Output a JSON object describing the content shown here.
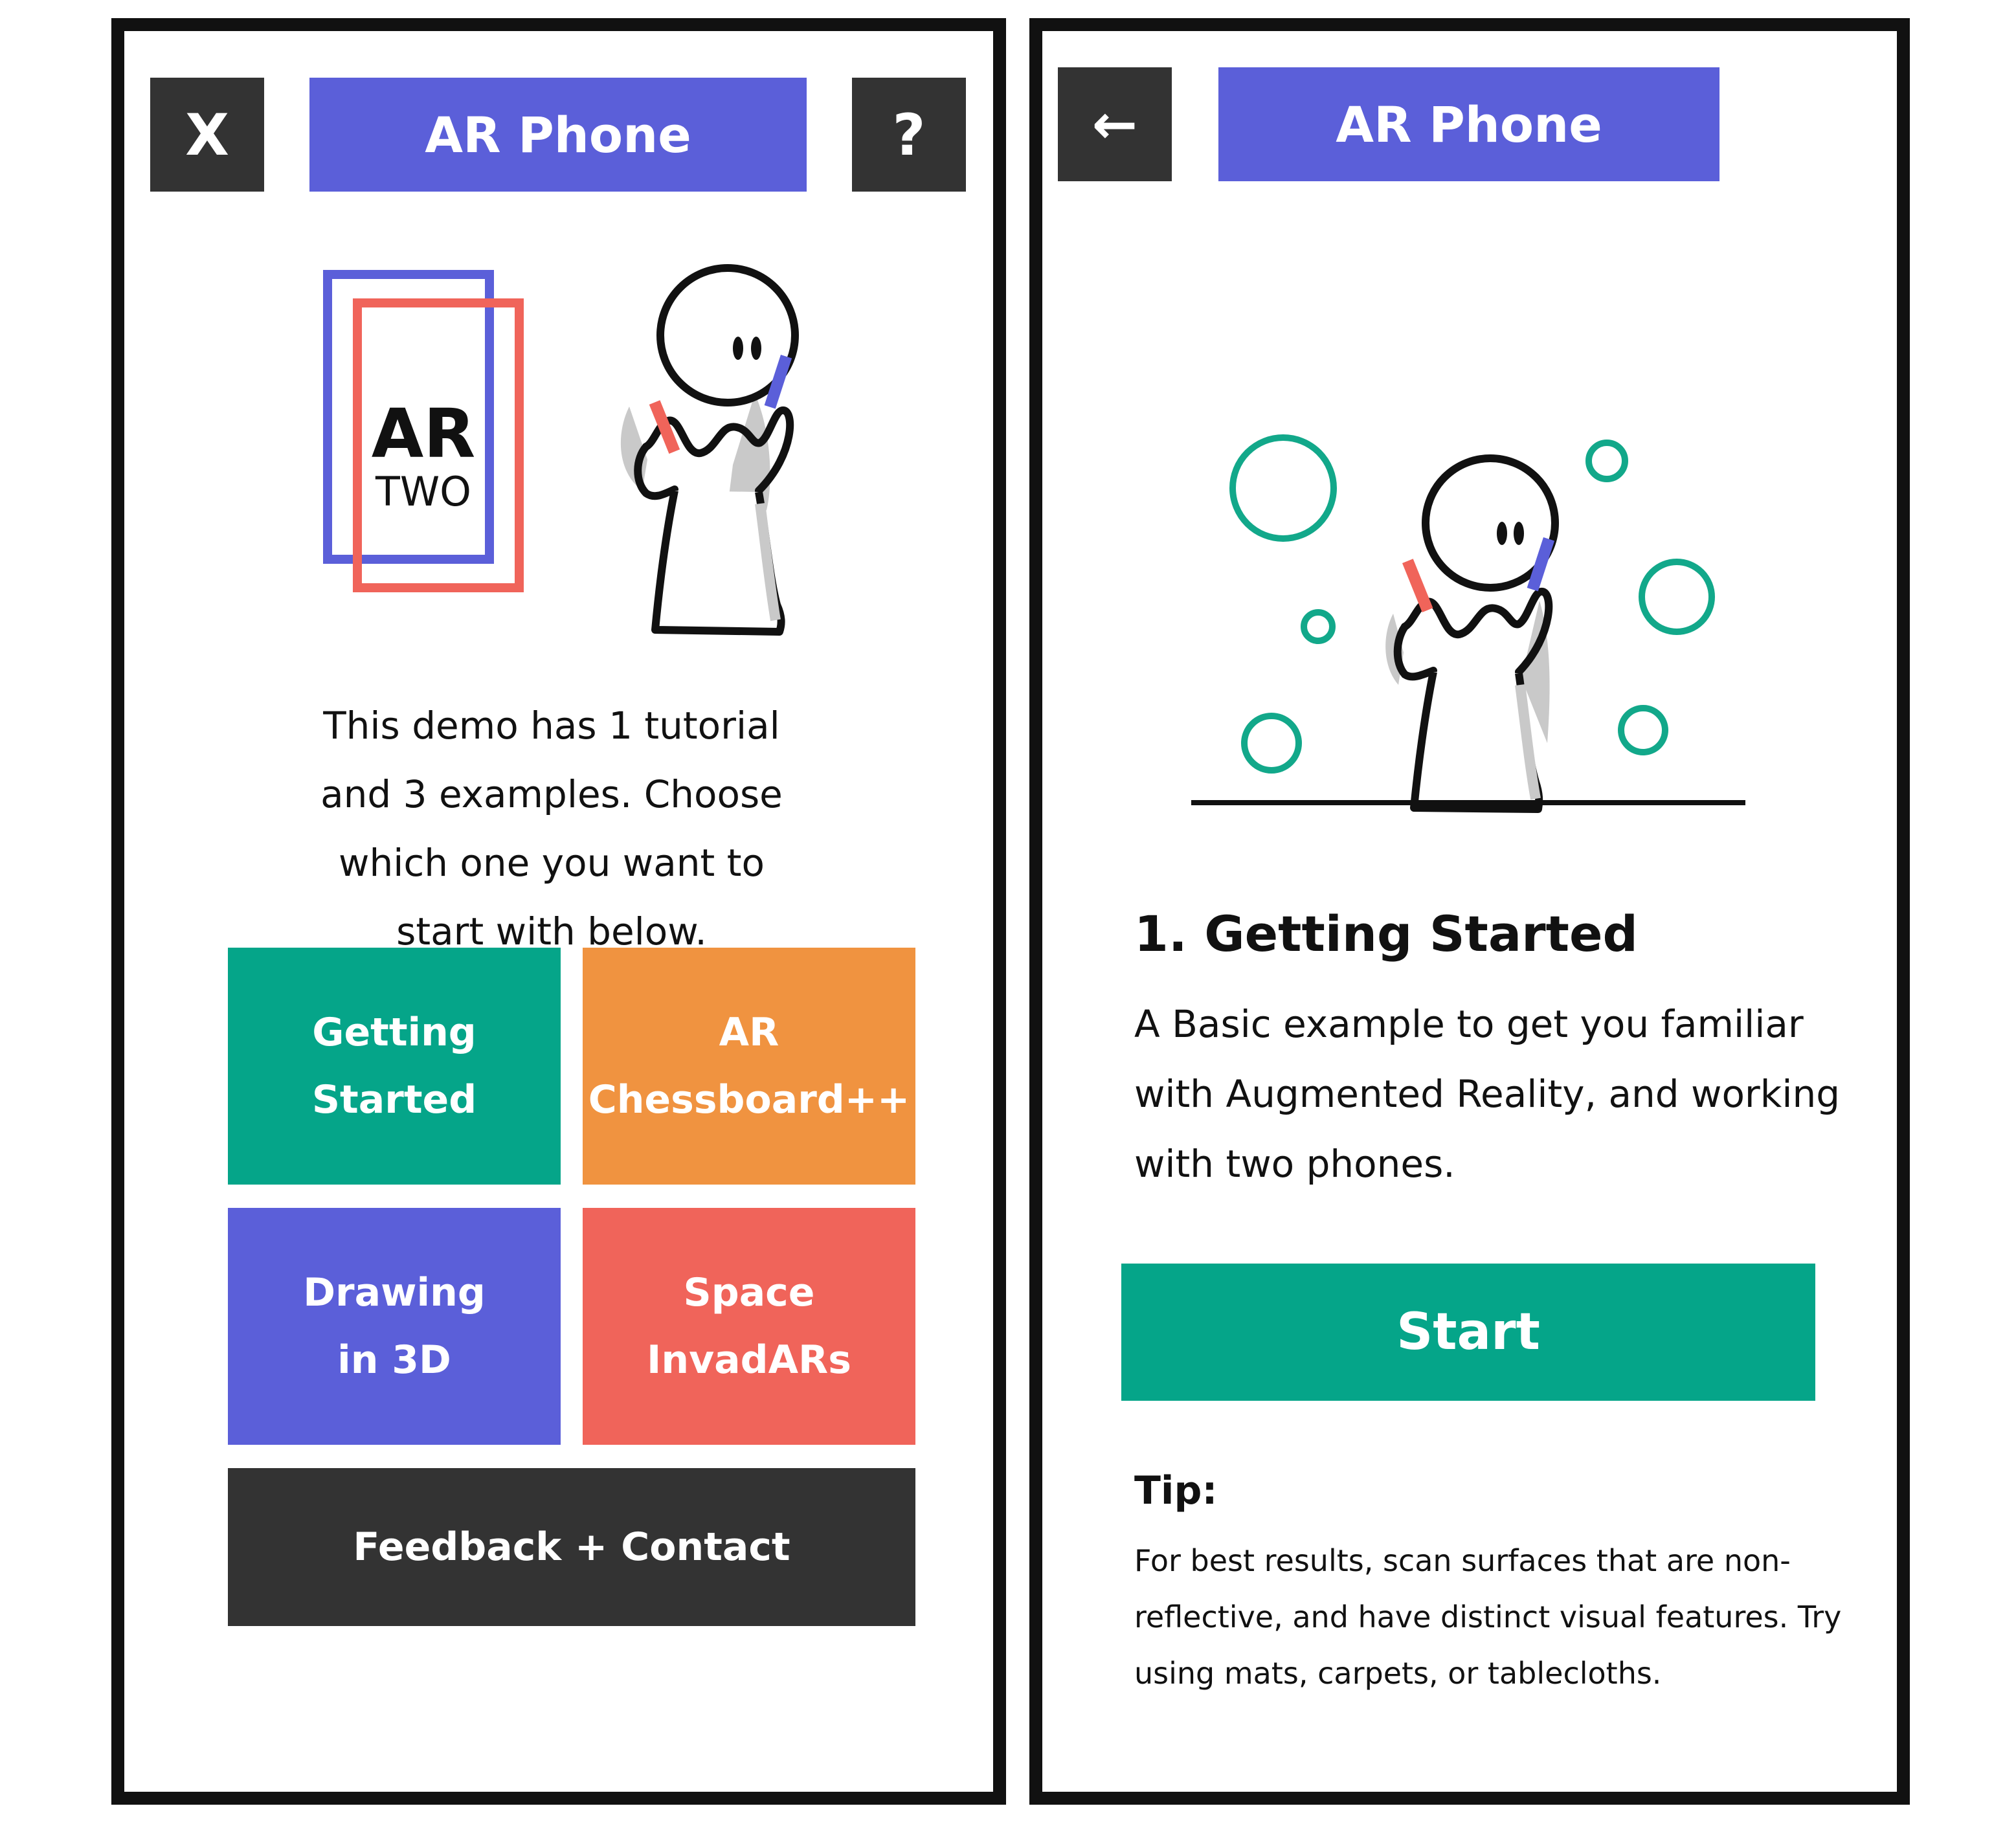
{
  "colors": {
    "accent_blue": "#5b5fd9",
    "accent_red": "#f0645a",
    "teal": "#05a589",
    "orange": "#f09340",
    "dark": "#333333",
    "circle_green": "#12a88a"
  },
  "left_screen": {
    "close_label": "X",
    "help_label": "?",
    "title": "AR Phone",
    "logo": {
      "line1": "AR",
      "line2": "TWO"
    },
    "intro_text": "This demo has 1 tutorial and 3 examples. Choose which one you want to start with below.",
    "tiles": [
      {
        "label": "Getting\nStarted",
        "color": "#05a589"
      },
      {
        "label": "AR\nChessboard++",
        "color": "#f09340"
      },
      {
        "label": "Drawing\nin 3D",
        "color": "#5b5fd9"
      },
      {
        "label": "Space\nInvadARs",
        "color": "#f0645a"
      }
    ],
    "feedback_label": "Feedback + Contact"
  },
  "right_screen": {
    "back_label": "←",
    "title": "AR Phone",
    "section_title": "1. Getting Started",
    "description": "A Basic example to get you familiar with Augmented Reality, and working with two phones.",
    "start_label": "Start",
    "tip_label": "Tip:",
    "tip_text": "For best results, scan surfaces that are non-reflective, and have distinct visual features. Try using mats, carpets, or tablecloths."
  }
}
